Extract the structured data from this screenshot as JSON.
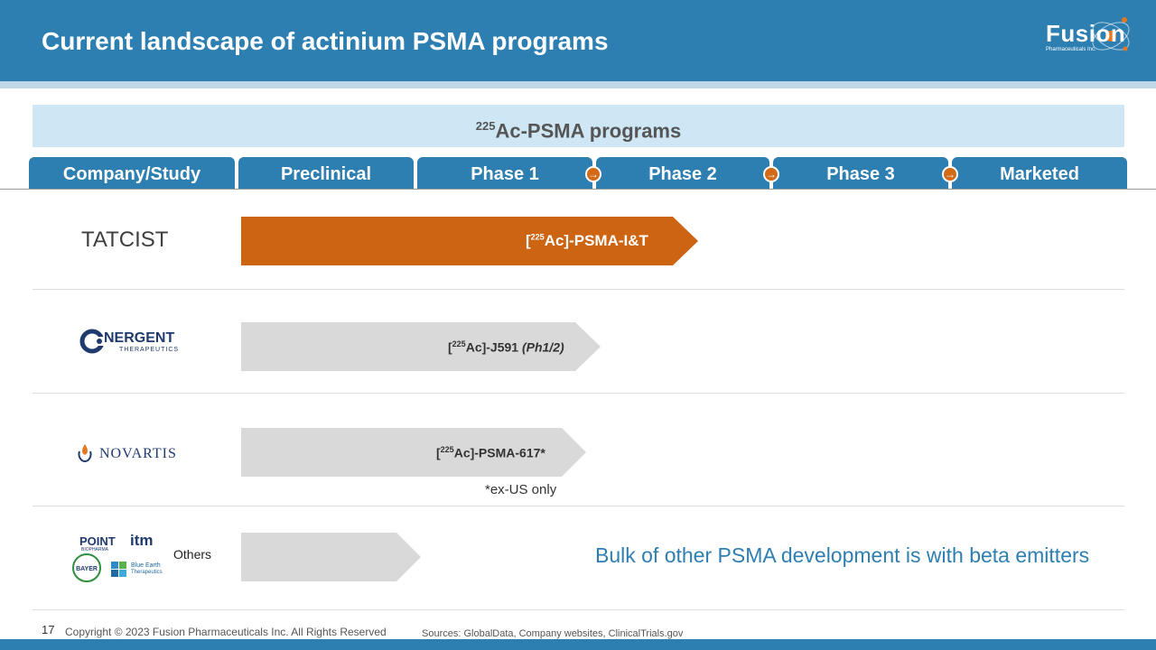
{
  "header": {
    "title": "Current landscape of actinium PSMA programs",
    "logo_text": "Fusion",
    "logo_sub": "Pharmaceuticals Inc."
  },
  "banner": {
    "superscript": "225",
    "text": "Ac-PSMA programs"
  },
  "tabs": [
    "Company/Study",
    "Preclinical",
    "Phase 1",
    "Phase 2",
    "Phase 3",
    "Marketed"
  ],
  "rows": [
    {
      "company": "TATCIST",
      "label_sup": "225",
      "label_pre": "[",
      "label_post": "Ac]-PSMA-I&T",
      "note": ""
    },
    {
      "company": "CONVERGENT THERAPEUTICS",
      "logo_main": "NERGENT",
      "logo_sub": "THERAPEUTICS",
      "label_pre": "[",
      "label_sup": "225",
      "label_post": "Ac]-J591 ",
      "label_italic": "(Ph1/2)"
    },
    {
      "company": "NOVARTIS",
      "logo_main": "NOVARTIS",
      "label_pre": "[",
      "label_sup": "225",
      "label_post": "Ac]-PSMA-617*",
      "footnote": "*ex-US only"
    },
    {
      "company": "Others",
      "others_logos": [
        "POINT",
        "BIOPHARMA",
        "itm",
        "BAYER",
        "Blue Earth",
        "Therapeutics"
      ]
    }
  ],
  "beta_note": "Bulk of other PSMA development is with beta emitters",
  "footer": {
    "page_number": "17",
    "copyright": "Copyright © 2023 Fusion Pharmaceuticals Inc. All Rights Reserved",
    "sources": "Sources: GlobalData, Company websites, ClinicalTrials.gov"
  },
  "colors": {
    "brand_blue": "#2e7fb1",
    "highlight_orange": "#cc6411",
    "gray_bar": "#d9d9d9",
    "banner_bg": "#cfe6f4"
  }
}
